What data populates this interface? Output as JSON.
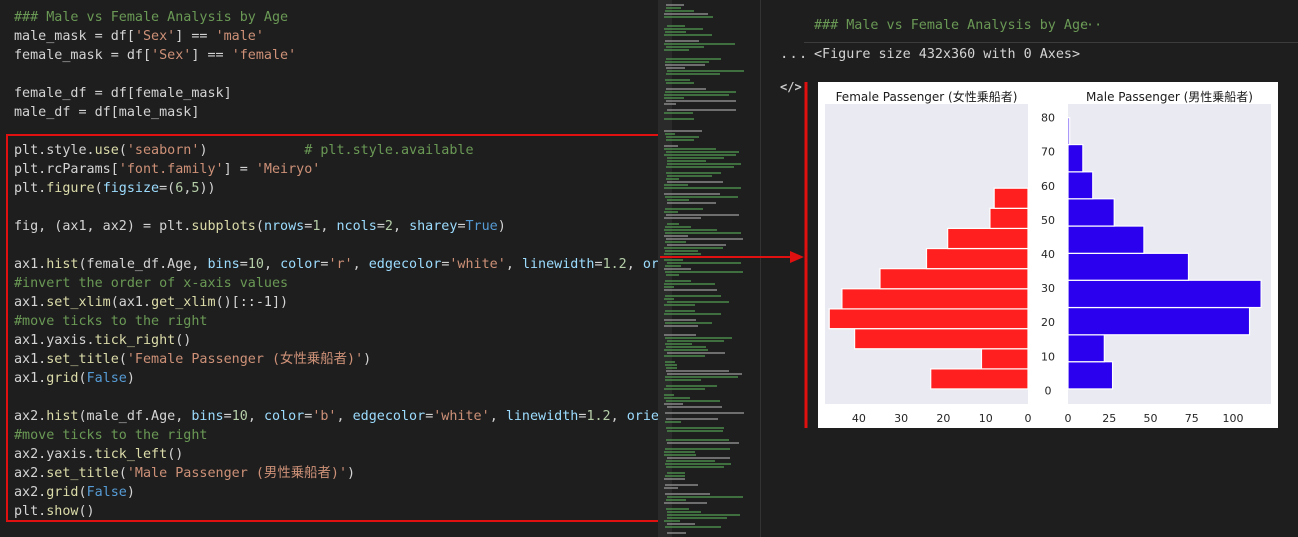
{
  "editor": {
    "lines": [
      [
        [
          "c",
          "### Male vs Female Analysis by Age"
        ]
      ],
      [
        [
          "p",
          "male_mask = df["
        ],
        [
          "s",
          "'Sex'"
        ],
        [
          "p",
          "] == "
        ],
        [
          "s",
          "'male'"
        ]
      ],
      [
        [
          "p",
          "female_mask = df["
        ],
        [
          "s",
          "'Sex'"
        ],
        [
          "p",
          "] == "
        ],
        [
          "s",
          "'female'"
        ]
      ],
      [],
      [
        [
          "p",
          "female_df = df[female_mask]"
        ]
      ],
      [
        [
          "p",
          "male_df = df[male_mask]"
        ]
      ],
      [],
      [
        [
          "p",
          "plt.style."
        ],
        [
          "f",
          "use"
        ],
        [
          "p",
          "("
        ],
        [
          "s",
          "'seaborn'"
        ],
        [
          "p",
          ")            "
        ],
        [
          "c",
          "# plt.style.available"
        ]
      ],
      [
        [
          "p",
          "plt.rcParams["
        ],
        [
          "s",
          "'font.family'"
        ],
        [
          "p",
          "] = "
        ],
        [
          "s",
          "'Meiryo'"
        ]
      ],
      [
        [
          "p",
          "plt."
        ],
        [
          "f",
          "figure"
        ],
        [
          "p",
          "("
        ],
        [
          "v",
          "figsize"
        ],
        [
          "p",
          "=("
        ],
        [
          "n",
          "6"
        ],
        [
          "p",
          ","
        ],
        [
          "n",
          "5"
        ],
        [
          "p",
          "))"
        ]
      ],
      [],
      [
        [
          "p",
          "fig, (ax1, ax2) = plt."
        ],
        [
          "f",
          "subplots"
        ],
        [
          "p",
          "("
        ],
        [
          "v",
          "nrows"
        ],
        [
          "p",
          "="
        ],
        [
          "n",
          "1"
        ],
        [
          "p",
          ", "
        ],
        [
          "v",
          "ncols"
        ],
        [
          "p",
          "="
        ],
        [
          "n",
          "2"
        ],
        [
          "p",
          ", "
        ],
        [
          "v",
          "sharey"
        ],
        [
          "p",
          "="
        ],
        [
          "k",
          "True"
        ],
        [
          "p",
          ")"
        ]
      ],
      [],
      [
        [
          "p",
          "ax1."
        ],
        [
          "f",
          "hist"
        ],
        [
          "p",
          "(female_df.Age, "
        ],
        [
          "v",
          "bins"
        ],
        [
          "p",
          "="
        ],
        [
          "n",
          "10"
        ],
        [
          "p",
          ", "
        ],
        [
          "v",
          "color"
        ],
        [
          "p",
          "="
        ],
        [
          "s",
          "'r'"
        ],
        [
          "p",
          ", "
        ],
        [
          "v",
          "edgecolor"
        ],
        [
          "p",
          "="
        ],
        [
          "s",
          "'white'"
        ],
        [
          "p",
          ", "
        ],
        [
          "v",
          "linewidth"
        ],
        [
          "p",
          "="
        ],
        [
          "n",
          "1.2"
        ],
        [
          "p",
          ", "
        ],
        [
          "v",
          "orient"
        ]
      ],
      [
        [
          "c",
          "#invert the order of x-axis values"
        ]
      ],
      [
        [
          "p",
          "ax1."
        ],
        [
          "f",
          "set_xlim"
        ],
        [
          "p",
          "(ax1."
        ],
        [
          "f",
          "get_xlim"
        ],
        [
          "p",
          "()[::-1])"
        ]
      ],
      [
        [
          "c",
          "#move ticks to the right"
        ]
      ],
      [
        [
          "p",
          "ax1.yaxis."
        ],
        [
          "f",
          "tick_right"
        ],
        [
          "p",
          "()"
        ]
      ],
      [
        [
          "p",
          "ax1."
        ],
        [
          "f",
          "set_title"
        ],
        [
          "p",
          "("
        ],
        [
          "s",
          "'Female Passenger (女性乗船者)'"
        ],
        [
          "p",
          ")"
        ]
      ],
      [
        [
          "p",
          "ax1."
        ],
        [
          "f",
          "grid"
        ],
        [
          "p",
          "("
        ],
        [
          "k",
          "False"
        ],
        [
          "p",
          ")"
        ]
      ],
      [],
      [
        [
          "p",
          "ax2."
        ],
        [
          "f",
          "hist"
        ],
        [
          "p",
          "(male_df.Age, "
        ],
        [
          "v",
          "bins"
        ],
        [
          "p",
          "="
        ],
        [
          "n",
          "10"
        ],
        [
          "p",
          ", "
        ],
        [
          "v",
          "color"
        ],
        [
          "p",
          "="
        ],
        [
          "s",
          "'b'"
        ],
        [
          "p",
          ", "
        ],
        [
          "v",
          "edgecolor"
        ],
        [
          "p",
          "="
        ],
        [
          "s",
          "'white'"
        ],
        [
          "p",
          ", "
        ],
        [
          "v",
          "linewidth"
        ],
        [
          "p",
          "="
        ],
        [
          "n",
          "1.2"
        ],
        [
          "p",
          ", "
        ],
        [
          "v",
          "orientat"
        ]
      ],
      [
        [
          "c",
          "#move ticks to the right"
        ]
      ],
      [
        [
          "p",
          "ax2.yaxis."
        ],
        [
          "f",
          "tick_left"
        ],
        [
          "p",
          "()"
        ]
      ],
      [
        [
          "p",
          "ax2."
        ],
        [
          "f",
          "set_title"
        ],
        [
          "p",
          "("
        ],
        [
          "s",
          "'Male Passenger (男性乗船者)'"
        ],
        [
          "p",
          ")"
        ]
      ],
      [
        [
          "p",
          "ax2."
        ],
        [
          "f",
          "grid"
        ],
        [
          "p",
          "("
        ],
        [
          "k",
          "False"
        ],
        [
          "p",
          ")"
        ]
      ],
      [
        [
          "p",
          "plt."
        ],
        [
          "f",
          "show"
        ],
        [
          "p",
          "()"
        ]
      ]
    ]
  },
  "output": {
    "markdown_title": "### Male vs Female Analysis by Age",
    "markdown_ellipsis": "···",
    "more_dots": "...",
    "figure_text": "<Figure size 432x360 with 0 Axes>",
    "code_icon": "</>"
  },
  "colors": {
    "highlight": "#e01010",
    "female": "#ff1f1f",
    "male": "#2b00ee",
    "plot_bg": "#eaeaf2"
  },
  "chart_data": {
    "type": "bar",
    "orientation": "horizontal",
    "series": [
      {
        "name": "Female Passenger (女性乗船者)",
        "color": "#ff1f1f",
        "bins": [
          [
            0.42,
            6.3
          ],
          [
            6.3,
            12.2
          ],
          [
            12.2,
            18.1
          ],
          [
            18.1,
            23.9
          ],
          [
            23.9,
            29.8
          ],
          [
            29.8,
            35.7
          ],
          [
            35.7,
            41.6
          ],
          [
            41.6,
            47.5
          ],
          [
            47.5,
            53.4
          ],
          [
            53.4,
            59.3
          ]
        ],
        "values": [
          23,
          11,
          41,
          47,
          44,
          35,
          24,
          19,
          9,
          8
        ],
        "xlim": [
          48,
          0
        ],
        "xticks": [
          40,
          30,
          20,
          10,
          0
        ]
      },
      {
        "name": "Male Passenger (男性乗船者)",
        "color": "#2b00ee",
        "bins": [
          [
            0.42,
            8.4
          ],
          [
            8.4,
            16.3
          ],
          [
            16.3,
            24.3
          ],
          [
            24.3,
            32.3
          ],
          [
            32.3,
            40.2
          ],
          [
            40.2,
            48.2
          ],
          [
            48.2,
            56.2
          ],
          [
            56.2,
            64.1
          ],
          [
            64.1,
            72.1
          ],
          [
            72.1,
            80
          ]
        ],
        "values": [
          27,
          22,
          110,
          117,
          73,
          46,
          28,
          15,
          9,
          1
        ],
        "xlim": [
          0,
          123
        ],
        "xticks": [
          0,
          25,
          50,
          75,
          100
        ]
      }
    ],
    "ylim": [
      -4,
      84
    ],
    "yticks": [
      0,
      10,
      20,
      30,
      40,
      50,
      60,
      70,
      80
    ],
    "ytick_position": "center"
  }
}
